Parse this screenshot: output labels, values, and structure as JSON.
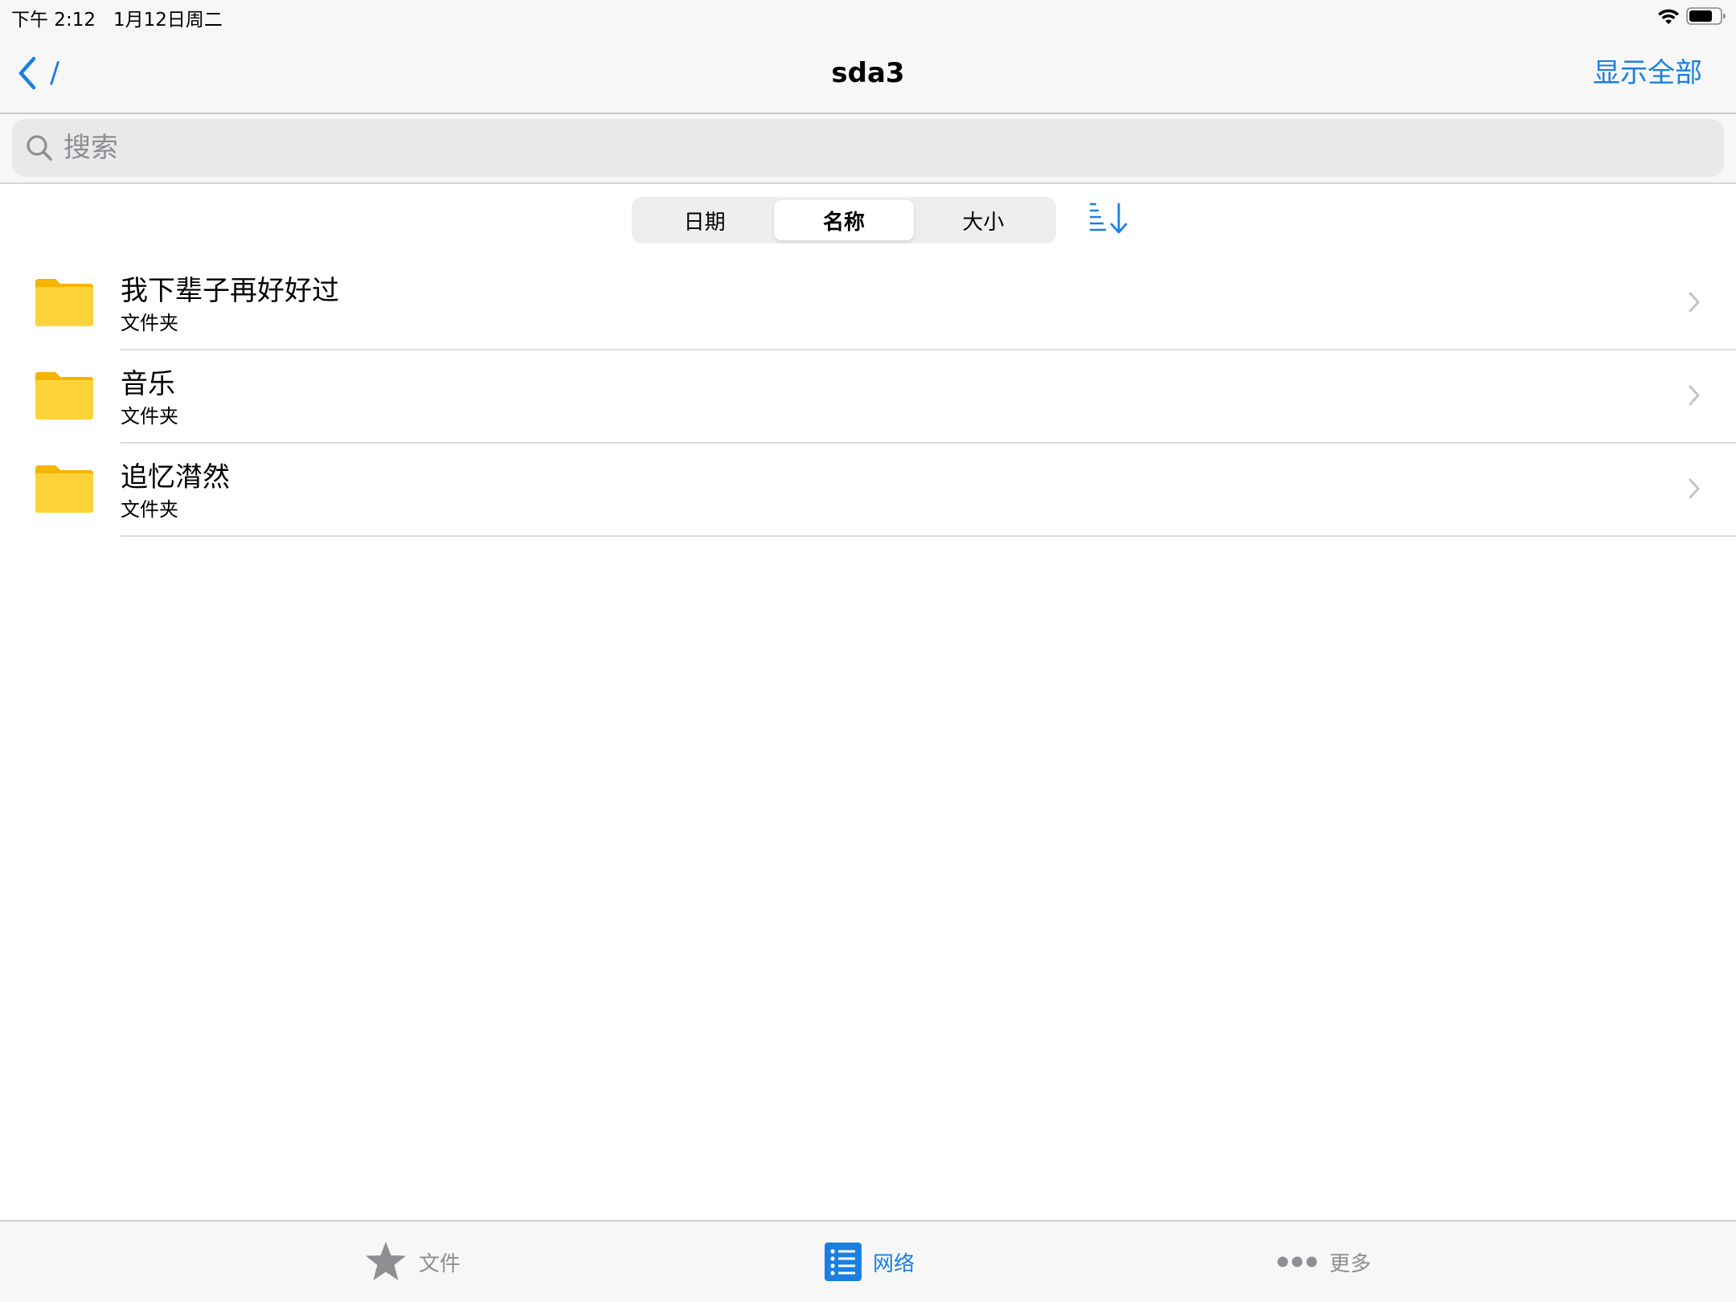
{
  "status_bar": {
    "time": "下午 2:12",
    "date": "1月12日周二"
  },
  "nav": {
    "back_label": "/",
    "title": "sda3",
    "show_all_label": "显示全部"
  },
  "search": {
    "placeholder": "搜索",
    "value": ""
  },
  "sort": {
    "segments": [
      {
        "label": "日期",
        "selected": false
      },
      {
        "label": "名称",
        "selected": true
      },
      {
        "label": "大小",
        "selected": false
      }
    ],
    "order_icon": "sort-descending-icon"
  },
  "files": [
    {
      "name": "我下辈子再好好过",
      "type": "文件夹",
      "icon": "folder-icon"
    },
    {
      "name": "音乐",
      "type": "文件夹",
      "icon": "folder-icon"
    },
    {
      "name": "追忆潸然",
      "type": "文件夹",
      "icon": "folder-icon"
    }
  ],
  "tab_bar": {
    "tabs": [
      {
        "label": "文件",
        "icon": "star-icon",
        "active": false
      },
      {
        "label": "网络",
        "icon": "network-list-icon",
        "active": true
      },
      {
        "label": "更多",
        "icon": "more-dots-icon",
        "active": false
      }
    ]
  },
  "colors": {
    "accent": "#1a7fe0",
    "folder": "#fdd33a",
    "folder_tab": "#f5b400",
    "inactive": "#8e8e93"
  }
}
